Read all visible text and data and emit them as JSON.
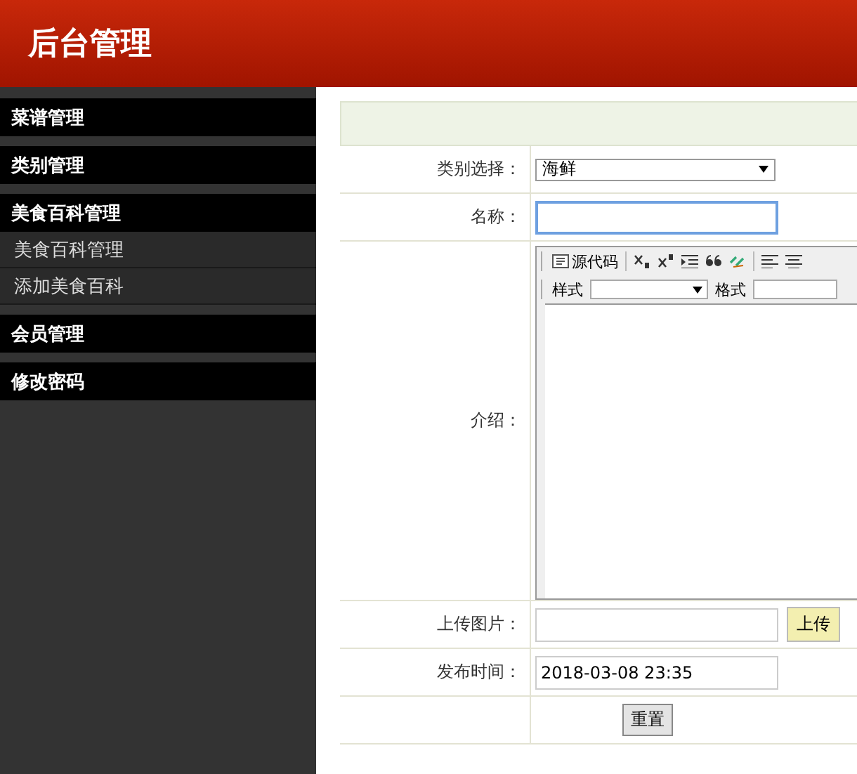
{
  "header": {
    "title": "后台管理"
  },
  "sidebar": {
    "groups": [
      {
        "label": "菜谱管理"
      },
      {
        "label": "类别管理"
      },
      {
        "label": "美食百科管理",
        "children": [
          {
            "label": "美食百科管理"
          },
          {
            "label": "添加美食百科"
          }
        ]
      },
      {
        "label": "会员管理"
      },
      {
        "label": "修改密码"
      }
    ]
  },
  "form": {
    "rows": [
      {
        "kind": "select",
        "label": "类别选择：",
        "value": "海鲜"
      },
      {
        "kind": "text",
        "label": "名称：",
        "focused": true
      },
      {
        "kind": "editor",
        "label": "介绍：",
        "source_button": "源代码",
        "style_label": "样式",
        "format_label": "格式"
      },
      {
        "kind": "upload",
        "label": "上传图片：",
        "button": "上传"
      },
      {
        "kind": "text",
        "label": "发布时间：",
        "value": "2018-03-08 23:35",
        "focused": false
      }
    ],
    "buttons": [
      "重置"
    ]
  }
}
